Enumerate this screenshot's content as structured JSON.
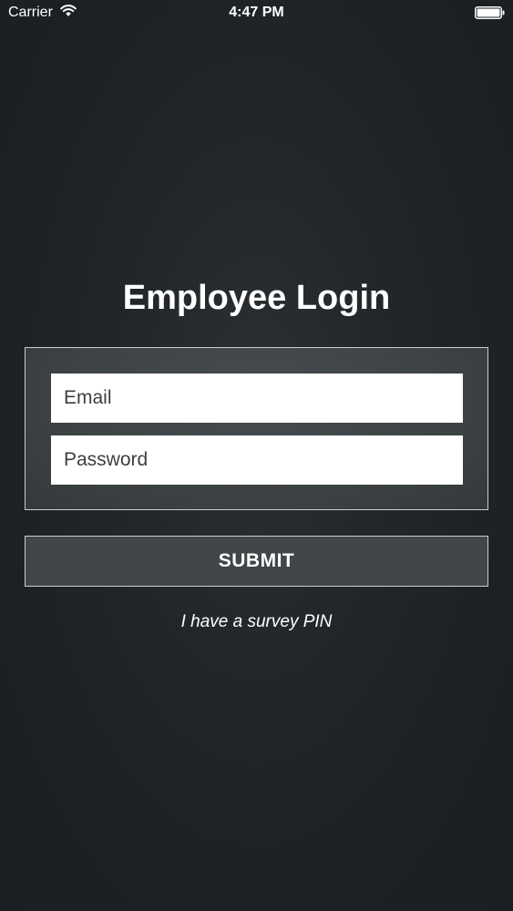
{
  "status_bar": {
    "carrier": "Carrier",
    "time": "4:47 PM",
    "icons": [
      "wifi-icon",
      "battery-icon"
    ]
  },
  "login": {
    "title": "Employee Login",
    "email_placeholder": "Email",
    "password_placeholder": "Password",
    "submit_label": "SUBMIT",
    "survey_link": "I have a survey PIN"
  },
  "colors": {
    "background": "#1e2224",
    "panel": "#3e4346",
    "button": "#414648",
    "border": "#c9cdd0",
    "text": "#ffffff"
  }
}
